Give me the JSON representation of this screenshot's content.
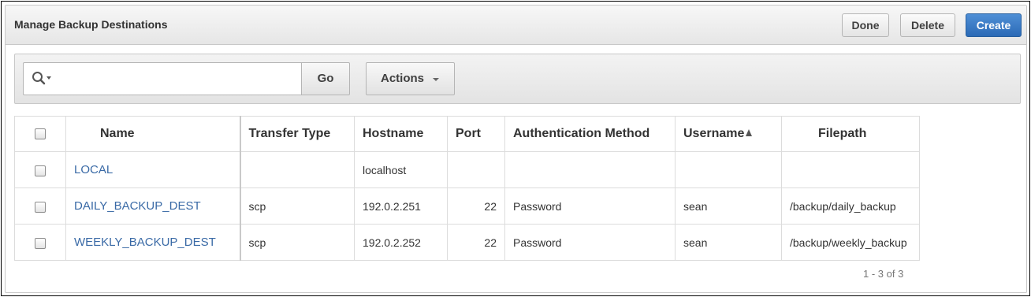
{
  "region": {
    "title": "Manage Backup Destinations",
    "buttons": {
      "done": "Done",
      "delete": "Delete",
      "create": "Create"
    },
    "accent_color": "#2f6fba"
  },
  "toolbar": {
    "search_value": "",
    "search_icon": "magnifier-with-dropdown",
    "go_label": "Go",
    "actions_label": "Actions"
  },
  "table": {
    "columns": [
      "Name",
      "Transfer Type",
      "Hostname",
      "Port",
      "Authentication Method",
      "Username",
      "Filepath"
    ],
    "sorted_column": "Username",
    "sort_direction": "ascending",
    "rows": [
      {
        "name": "LOCAL",
        "transfer_type": "",
        "hostname": "localhost",
        "port": "",
        "auth_method": "",
        "username": "",
        "filepath": ""
      },
      {
        "name": "DAILY_BACKUP_DEST",
        "transfer_type": "scp",
        "hostname": "192.0.2.251",
        "port": "22",
        "auth_method": "Password",
        "username": "sean",
        "filepath": "/backup/daily_backup"
      },
      {
        "name": "WEEKLY_BACKUP_DEST",
        "transfer_type": "scp",
        "hostname": "192.0.2.252",
        "port": "22",
        "auth_method": "Password",
        "username": "sean",
        "filepath": "/backup/weekly_backup"
      }
    ]
  },
  "pagination": {
    "text": "1 - 3 of 3"
  }
}
